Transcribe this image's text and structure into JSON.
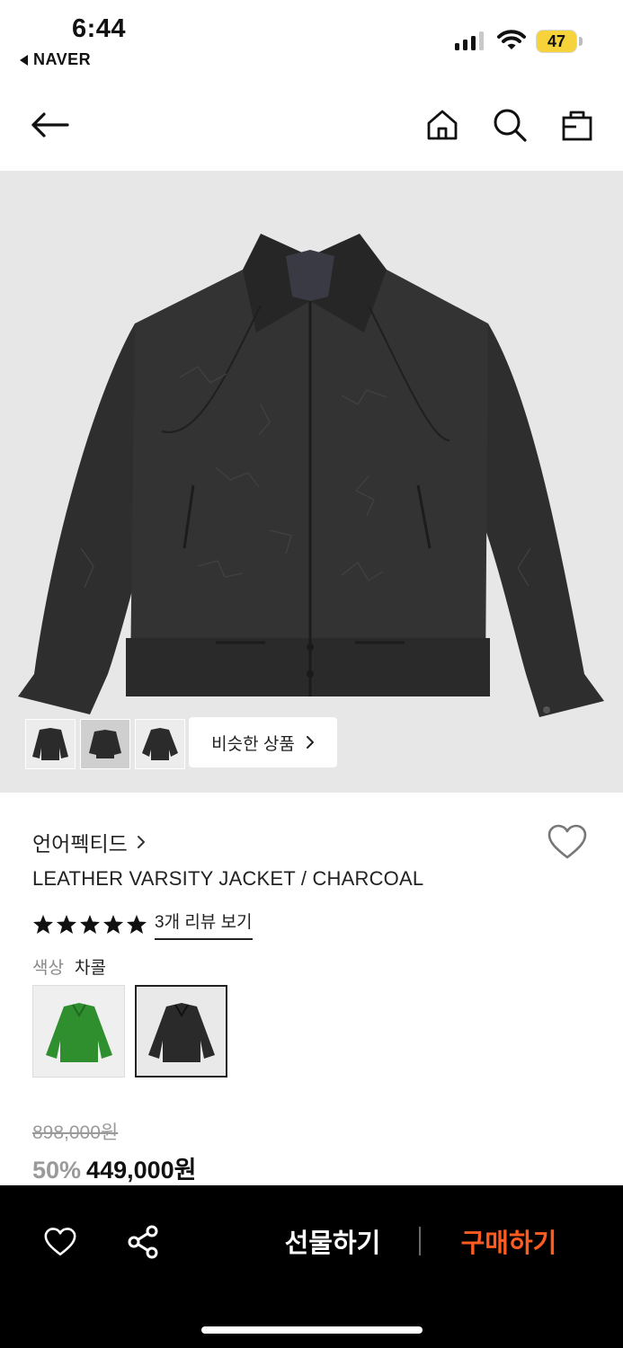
{
  "status_bar": {
    "time": "6:44",
    "back_app": "NAVER",
    "battery": "47"
  },
  "header": {
    "icons": [
      "back-arrow-icon",
      "home-icon",
      "search-icon",
      "shopping-bag-icon"
    ]
  },
  "gallery": {
    "similar_label": "비슷한 상품",
    "thumbnails": [
      "jacket-front-thumb",
      "jacket-back-thumb",
      "jacket-detail-thumb"
    ],
    "active_thumbnail_index": 1,
    "background_color": "#e7e7e7"
  },
  "product": {
    "brand": "언어펙티드",
    "name": "LEATHER VARSITY JACKET / CHARCOAL",
    "rating_stars": 5,
    "review_link": "3개 리뷰 보기",
    "color_label": "색상",
    "color_value": "차콜",
    "swatches": [
      {
        "color": "green",
        "hex": "#2f8f2f",
        "selected": false
      },
      {
        "color": "charcoal",
        "hex": "#2a2a2a",
        "selected": true
      }
    ],
    "original_price": "898,000원",
    "discount": "50%",
    "price": "449,000원"
  },
  "bottom_bar": {
    "gift_label": "선물하기",
    "buy_label": "구매하기",
    "buy_color": "#ff5a1f"
  }
}
